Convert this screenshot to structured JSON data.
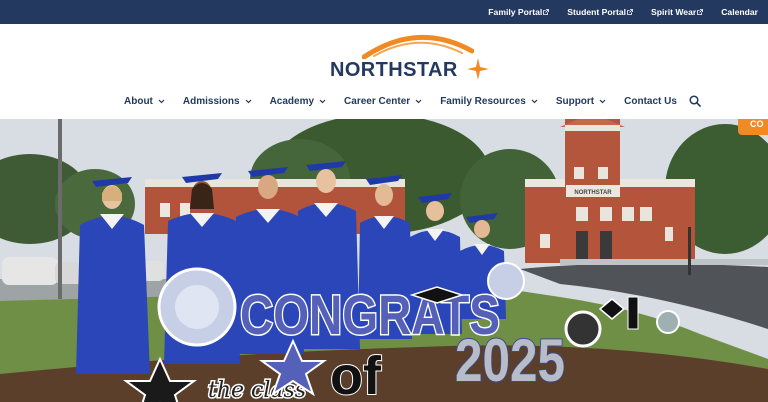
{
  "topbar": {
    "links": [
      {
        "label": "Family Portal",
        "icon": "external-link-icon"
      },
      {
        "label": "Student Portal",
        "icon": "external-link-icon"
      },
      {
        "label": "Spirit Wear",
        "icon": "external-link-icon"
      },
      {
        "label": "Calendar"
      }
    ]
  },
  "logo": {
    "text": "NORTHSTAR"
  },
  "nav": {
    "items": [
      {
        "label": "About"
      },
      {
        "label": "Admissions"
      },
      {
        "label": "Academy"
      },
      {
        "label": "Career Center"
      },
      {
        "label": "Family Resources"
      },
      {
        "label": "Support"
      },
      {
        "label": "Contact Us"
      }
    ],
    "search_icon": "search-icon"
  },
  "hero": {
    "building_sign": "NORTHSTAR",
    "yard_sign_word": "CONGRATS",
    "yard_sign_year": "2025",
    "yard_sign_class": "of",
    "script_text": "the class",
    "side_tab": "CO"
  },
  "colors": {
    "navy": "#24395f",
    "orange": "#f28a24",
    "gown_blue": "#2a46b8"
  }
}
